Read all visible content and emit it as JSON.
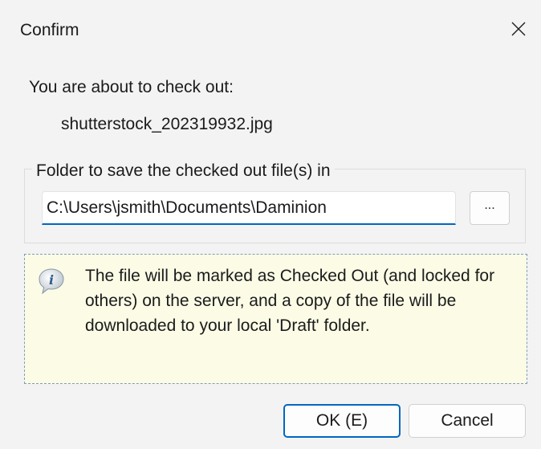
{
  "window": {
    "title": "Confirm"
  },
  "message": {
    "intro": "You are about to check out:",
    "filename": "shutterstock_202319932.jpg"
  },
  "folder_group": {
    "legend": "Folder to save the checked out file(s) in",
    "path_value": "C:\\Users\\jsmith\\Documents\\Daminion",
    "browse_label": "..."
  },
  "info": {
    "icon": "info-icon",
    "text": "The file will be marked as Checked Out (and locked for others) on the server, and a copy of the file will be downloaded to your local 'Draft' folder."
  },
  "buttons": {
    "ok_label": "OK (E)",
    "cancel_label": "Cancel"
  },
  "colors": {
    "accent": "#0067c0",
    "info_background": "#fbfbe6",
    "dialog_background": "#f3f3f3"
  }
}
